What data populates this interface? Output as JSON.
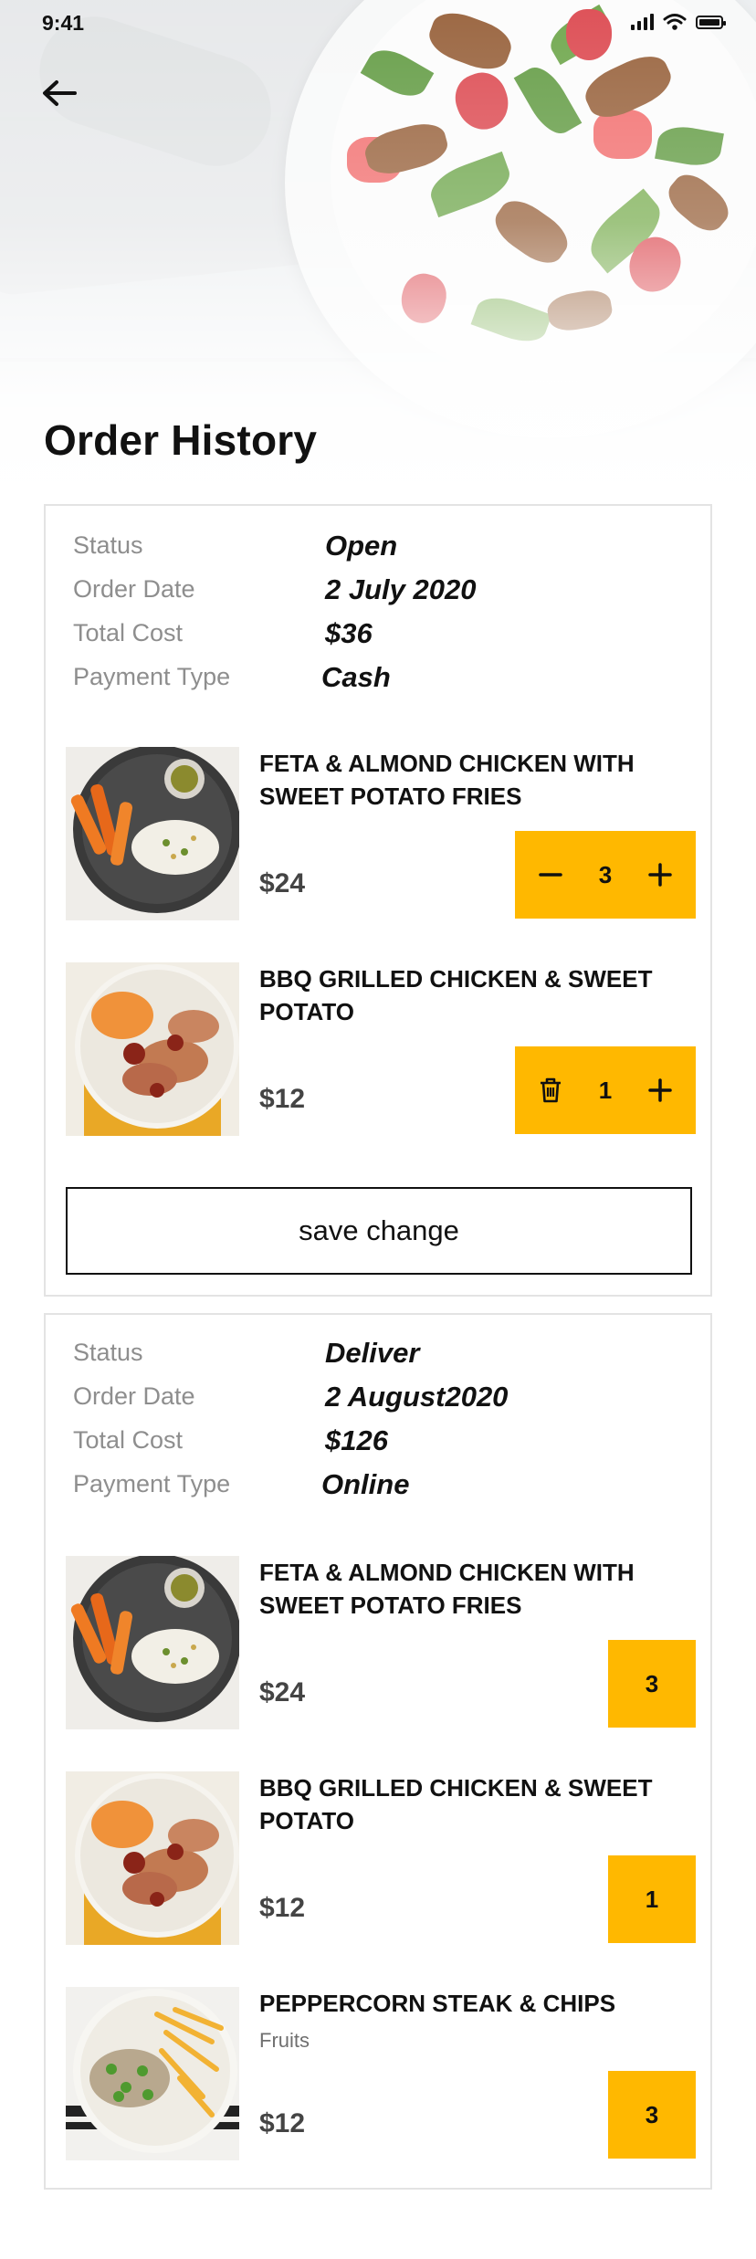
{
  "status_bar": {
    "time": "9:41"
  },
  "header": {
    "title": "Order History"
  },
  "labels": {
    "status": "Status",
    "order_date": "Order Date",
    "total_cost": "Total Cost",
    "payment_type": "Payment Type"
  },
  "orders": [
    {
      "status": "Open",
      "order_date": "2 July 2020",
      "total_cost": "$36",
      "payment_type": "Cash",
      "items": [
        {
          "name": "FETA & ALMOND CHICKEN WITH SWEET POTATO FRIES",
          "price": "$24",
          "qty": "3"
        },
        {
          "name": "BBQ GRILLED CHICKEN & SWEET POTATO",
          "price": "$12",
          "qty": "1"
        }
      ],
      "save_label": "save change"
    },
    {
      "status": "Deliver",
      "order_date": "2 August2020",
      "total_cost": "$126",
      "payment_type": "Online",
      "items": [
        {
          "name": "FETA & ALMOND CHICKEN WITH SWEET POTATO FRIES",
          "price": "$24",
          "qty": "3"
        },
        {
          "name": "BBQ GRILLED CHICKEN & SWEET POTATO",
          "price": "$12",
          "qty": "1"
        },
        {
          "name": "PEPPERCORN STEAK & CHIPS",
          "subtitle": "Fruits",
          "price": "$12",
          "qty": "3"
        }
      ]
    }
  ],
  "colors": {
    "accent": "#ffb800",
    "text": "#111111",
    "muted": "#8e8e8e"
  },
  "icons": [
    "back-arrow-icon",
    "signal-icon",
    "wifi-icon",
    "battery-icon",
    "minus-icon",
    "plus-icon",
    "trash-icon"
  ]
}
